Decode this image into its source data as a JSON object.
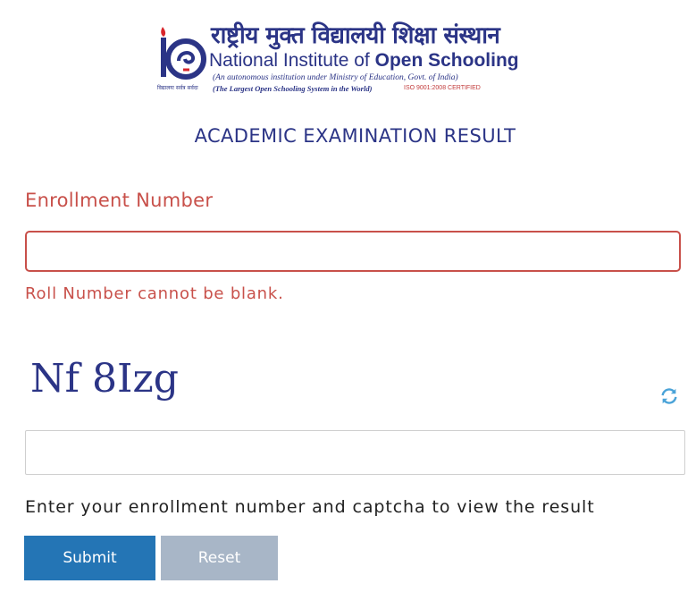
{
  "logo": {
    "hindi_name": "राष्ट्रीय मुक्त विद्यालयी शिक्षा संस्थान",
    "english_name_part1": "National Institute of ",
    "english_name_part2": "Open Schooling",
    "subtitle": "(An autonomous institution under Ministry of Education, Govt. of India)",
    "tagline_en": "(The Largest Open Schooling System in the World)",
    "iso": "ISO 9001:2008 CERTIFIED",
    "emblem_text": "विद्यालयः सर्वत्र सर्वदा"
  },
  "page": {
    "heading": "ACADEMIC EXAMINATION RESULT"
  },
  "form": {
    "enrollment_label": "Enrollment Number",
    "enrollment_value": "",
    "error_message": "Roll Number cannot be blank.",
    "captcha_text": "Nf 8Izg",
    "captcha_value": "",
    "instruction": "Enter your enrollment number and captcha to view the result",
    "submit_label": "Submit",
    "reset_label": "Reset"
  },
  "colors": {
    "brand_blue": "#2b3486",
    "error_red": "#c8504a",
    "submit_blue": "#2475b5",
    "reset_gray": "#a8b6c7",
    "refresh_icon": "#4aa3d8"
  },
  "icons": {
    "refresh": "refresh-icon",
    "emblem": "nios-emblem-icon"
  }
}
